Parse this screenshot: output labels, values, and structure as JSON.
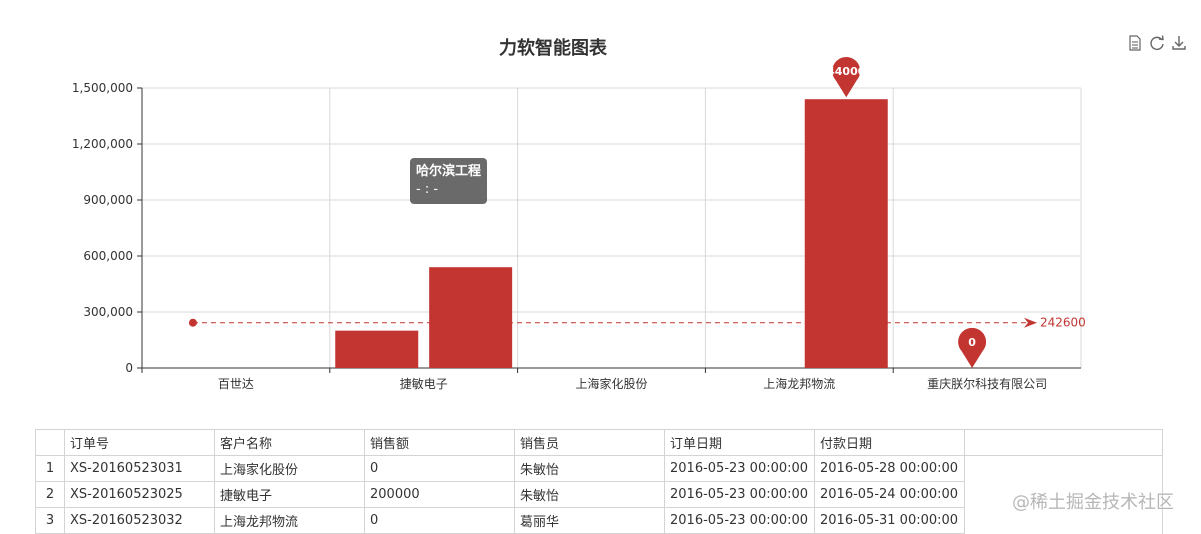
{
  "chart_data": {
    "type": "bar",
    "title": "力软智能图表",
    "categories": [
      "百世达",
      "捷敏电子",
      "上海家化股份",
      "上海龙邦物流",
      "重庆朕尔科技有限公司"
    ],
    "series": [
      {
        "values": [
          0,
          200000,
          540000,
          0,
          1440000
        ]
      }
    ],
    "y_ticks": [
      "0",
      "300,000",
      "600,000",
      "900,000",
      "1,200,000",
      "1,500,000"
    ],
    "ylim": [
      0,
      1500000
    ],
    "mark_line": {
      "value": 242600,
      "label": "242600"
    },
    "mark_points": [
      {
        "type": "max",
        "label": "44000",
        "category": "重庆朕尔科技有限公司",
        "value": 1440000
      },
      {
        "type": "min",
        "label": "0",
        "category": "重庆朕尔科技有限公司",
        "value": 0
      }
    ],
    "grid": true,
    "bar_color": "#c23531"
  },
  "tooltip": {
    "title": "哈尔滨工程",
    "line": "- : -"
  },
  "toolbox": {
    "icons": [
      "data-view-icon",
      "refresh-icon",
      "download-icon"
    ]
  },
  "table": {
    "columns": [
      "订单号",
      "客户名称",
      "销售额",
      "销售员",
      "订单日期",
      "付款日期"
    ],
    "rows": [
      {
        "num": "1",
        "cells": [
          "XS-20160523031",
          "上海家化股份",
          "0",
          "朱敏怡",
          "2016-05-23 00:00:00",
          "2016-05-28 00:00:00"
        ]
      },
      {
        "num": "2",
        "cells": [
          "XS-20160523025",
          "捷敏电子",
          "200000",
          "朱敏怡",
          "2016-05-23 00:00:00",
          "2016-05-24 00:00:00"
        ]
      },
      {
        "num": "3",
        "cells": [
          "XS-20160523032",
          "上海龙邦物流",
          "0",
          "葛丽华",
          "2016-05-23 00:00:00",
          "2016-05-31 00:00:00"
        ]
      }
    ]
  },
  "watermark": "@稀土掘金技术社区"
}
